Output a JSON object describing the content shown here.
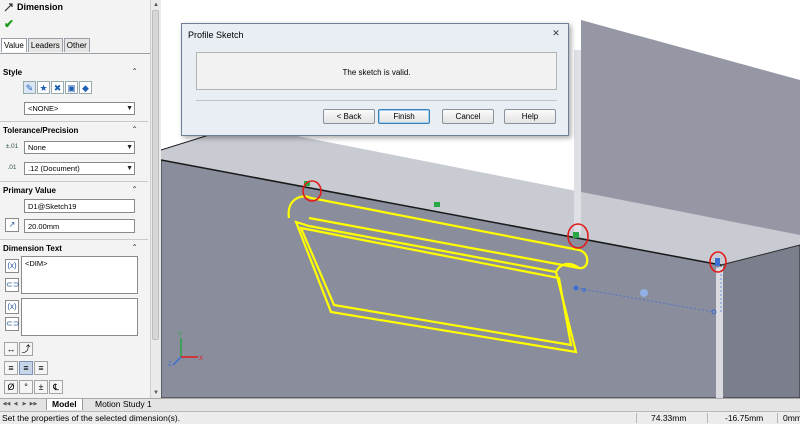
{
  "panel": {
    "title": "Dimension",
    "tabs": [
      "Value",
      "Leaders",
      "Other"
    ],
    "style": {
      "heading": "Style",
      "style_value": "<NONE>"
    },
    "tolerance": {
      "heading": "Tolerance/Precision",
      "tolerance_type": "None",
      "precision": ".12 (Document)"
    },
    "primary_value": {
      "heading": "Primary Value",
      "name": "D1@Sketch19",
      "value": "20.00mm"
    },
    "dimension_text": {
      "heading": "Dimension Text",
      "text": "<DIM>"
    },
    "symbols": [
      "Ø",
      "°",
      "±",
      "℄"
    ]
  },
  "dialog": {
    "title": "Profile Sketch",
    "message": "The sketch is valid.",
    "buttons": {
      "back": "< Back",
      "finish": "Finish",
      "cancel": "Cancel",
      "help": "Help"
    }
  },
  "bottom_tabs": [
    "Model",
    "Motion Study 1"
  ],
  "status": {
    "message": "Set the properties of the selected dimension(s).",
    "x": "74.33mm",
    "y": "-16.75mm",
    "z": "0mm"
  },
  "colors": {
    "wall_front": "#8a8d9c",
    "wall_top": "#c9cbd3",
    "wall_dark": "#6d7080",
    "sketch": "#ffff00",
    "annotation_red": "#e21b1b",
    "dim_blue": "#3b6fd4",
    "dialog_bg": "#e9eef5"
  }
}
